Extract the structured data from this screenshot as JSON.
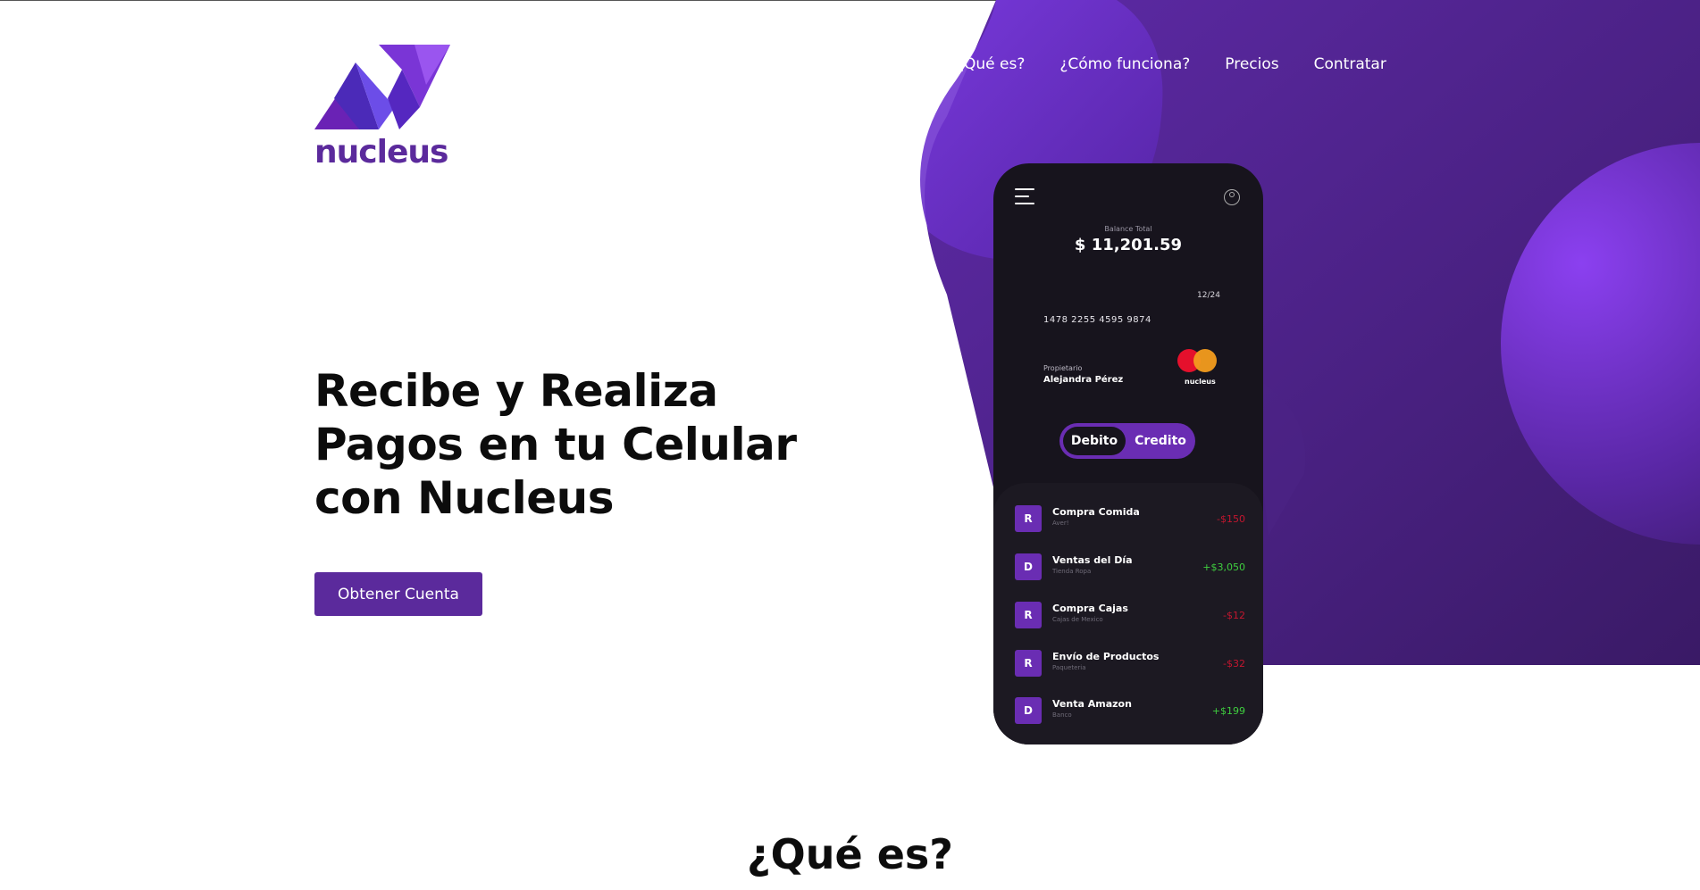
{
  "brand": {
    "name": "nucleus"
  },
  "nav": {
    "items": [
      {
        "label": "¿Qué es?"
      },
      {
        "label": "¿Cómo funciona?"
      },
      {
        "label": "Precios"
      },
      {
        "label": "Contratar"
      }
    ]
  },
  "hero": {
    "title": "Recibe y Realiza Pagos en tu Celular con Nucleus",
    "cta_label": "Obtener Cuenta"
  },
  "phone": {
    "balance_label": "Balance Total",
    "balance": "$ 11,201.59",
    "card": {
      "expiry": "12/24",
      "number": "1478 2255 4595 9874",
      "owner_label": "Propietario",
      "owner": "Alejandra Pérez",
      "issuer_label": "nucleus"
    },
    "toggle": {
      "left": "Debito",
      "right": "Credito",
      "selected": "Debito"
    },
    "transactions": [
      {
        "badge": "R",
        "name": "Compra Comida",
        "sub": "Aver!",
        "amount": "-$150",
        "type": "neg"
      },
      {
        "badge": "D",
        "name": "Ventas del Día",
        "sub": "Tienda Ropa",
        "amount": "+$3,050",
        "type": "pos"
      },
      {
        "badge": "R",
        "name": "Compra Cajas",
        "sub": "Cajas de Mexico",
        "amount": "-$12",
        "type": "neg"
      },
      {
        "badge": "R",
        "name": "Envío de Productos",
        "sub": "Paqueteria",
        "amount": "-$32",
        "type": "neg"
      },
      {
        "badge": "D",
        "name": "Venta Amazon",
        "sub": "Banco",
        "amount": "+$199",
        "type": "pos"
      }
    ]
  },
  "section": {
    "title": "¿Qué es?"
  },
  "colors": {
    "brand_purple": "#5b2a9c",
    "accent_purple": "#6a2db3",
    "phone_bg": "#17141d",
    "negative": "#c4162f",
    "positive": "#3fcf3f"
  }
}
